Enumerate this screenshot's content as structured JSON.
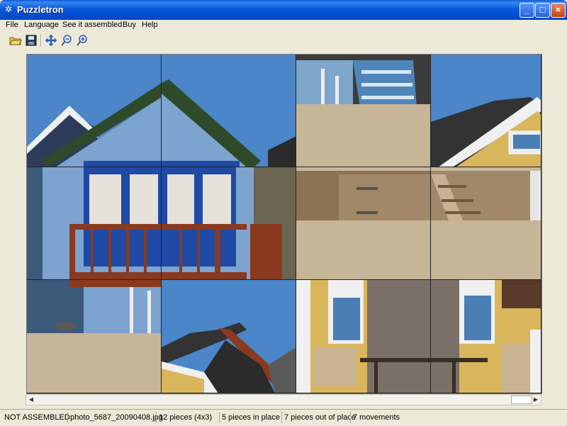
{
  "window": {
    "title": "Puzzletron",
    "icon": "puzzle-app-icon"
  },
  "controls": {
    "minimize": "_",
    "maximize": "□",
    "close": "×"
  },
  "menu": [
    "File",
    "Language",
    "See it assembled",
    "Buy",
    "Help"
  ],
  "toolbar": [
    "open-folder-icon",
    "save-icon",
    "move-icon",
    "zoom-out-icon",
    "zoom-in-icon"
  ],
  "puzzle": {
    "rows": 3,
    "cols": 4,
    "pieces": [
      "beach-hut-roof-left",
      "beach-hut-roof-right",
      "steps-and-sand",
      "yellow-hut-roof",
      "hut-door-left",
      "hut-door-right",
      "wooden-fence-steps",
      "fence-and-sand",
      "hut-base-sand",
      "orange-roof-sky",
      "yellow-hut-window",
      "yellow-hut-bench"
    ]
  },
  "status": {
    "state": "NOT ASSEMBLED",
    "file": "photo_5687_20090408.jpg",
    "pieces": "12 pieces (4x3)",
    "in_place": "5 pieces in place",
    "out_of_place": "7 pieces out of place",
    "movements": "7 movements"
  }
}
